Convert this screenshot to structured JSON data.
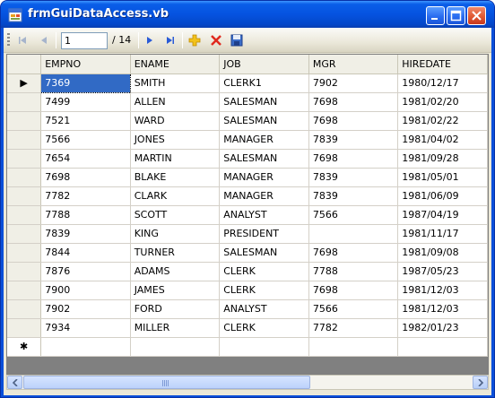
{
  "window": {
    "title": "frmGuiDataAccess.vb",
    "icon": "app-form-icon",
    "controls": [
      "minimize-icon",
      "maximize-icon",
      "close-icon"
    ]
  },
  "toolbar": {
    "position_value": "1",
    "count_text": "/ 14",
    "buttons": [
      "move-first-icon",
      "move-previous-icon",
      "move-next-icon",
      "move-last-icon",
      "add-new-icon",
      "delete-icon",
      "save-icon"
    ]
  },
  "grid": {
    "columns": [
      "EMPNO",
      "ENAME",
      "JOB",
      "MGR",
      "HIREDATE"
    ],
    "rows": [
      [
        "7369",
        "SMITH",
        "CLERK1",
        "7902",
        "1980/12/17"
      ],
      [
        "7499",
        "ALLEN",
        "SALESMAN",
        "7698",
        "1981/02/20"
      ],
      [
        "7521",
        "WARD",
        "SALESMAN",
        "7698",
        "1981/02/22"
      ],
      [
        "7566",
        "JONES",
        "MANAGER",
        "7839",
        "1981/04/02"
      ],
      [
        "7654",
        "MARTIN",
        "SALESMAN",
        "7698",
        "1981/09/28"
      ],
      [
        "7698",
        "BLAKE",
        "MANAGER",
        "7839",
        "1981/05/01"
      ],
      [
        "7782",
        "CLARK",
        "MANAGER",
        "7839",
        "1981/06/09"
      ],
      [
        "7788",
        "SCOTT",
        "ANALYST",
        "7566",
        "1987/04/19"
      ],
      [
        "7839",
        "KING",
        "PRESIDENT",
        "",
        "1981/11/17"
      ],
      [
        "7844",
        "TURNER",
        "SALESMAN",
        "7698",
        "1981/09/08"
      ],
      [
        "7876",
        "ADAMS",
        "CLERK",
        "7788",
        "1987/05/23"
      ],
      [
        "7900",
        "JAMES",
        "CLERK",
        "7698",
        "1981/12/03"
      ],
      [
        "7902",
        "FORD",
        "ANALYST",
        "7566",
        "1981/12/03"
      ],
      [
        "7934",
        "MILLER",
        "CLERK",
        "7782",
        "1982/01/23"
      ]
    ],
    "current_row_glyph": "▶",
    "new_row_glyph": "✱",
    "selection_color": "#316ac5"
  }
}
